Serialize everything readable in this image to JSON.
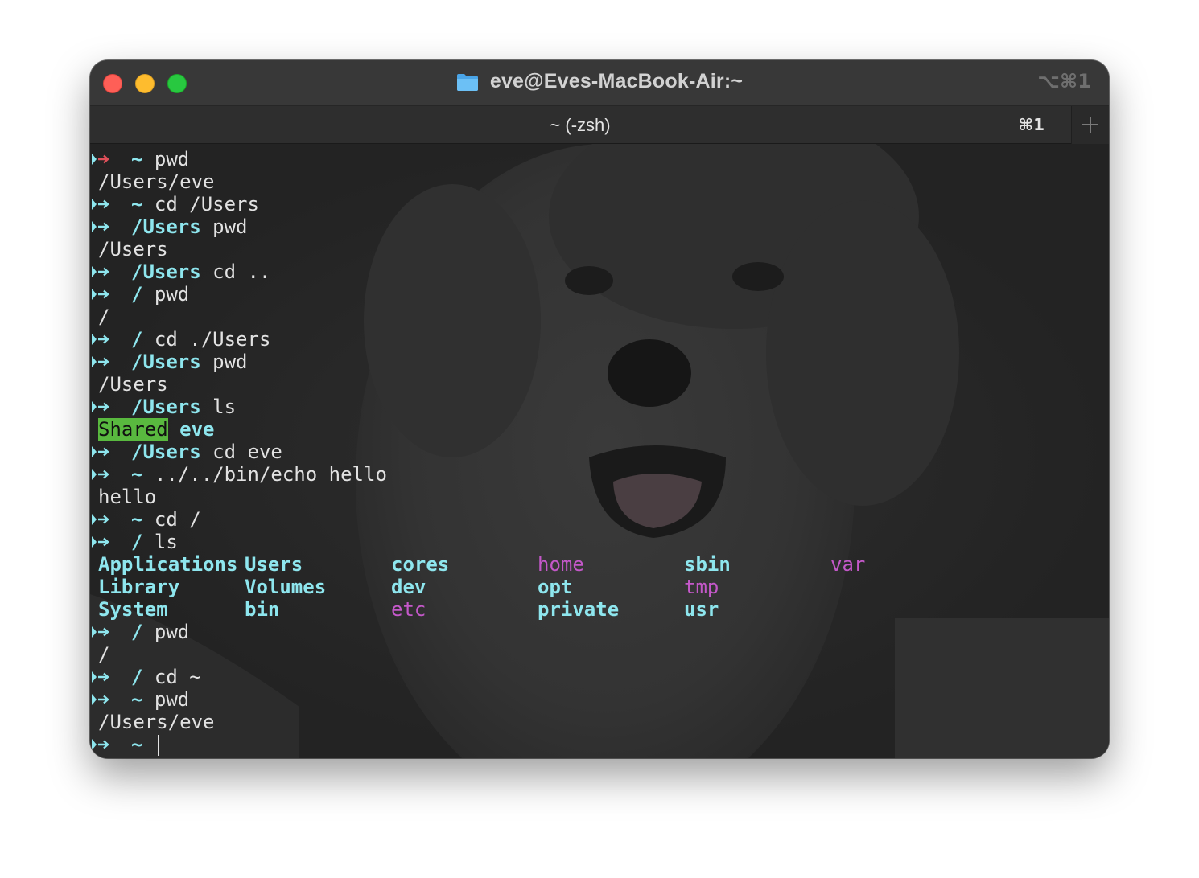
{
  "window": {
    "title": "eve@Eves-MacBook-Air:~",
    "title_icon": "folder-icon",
    "shortcut": "⌥⌘1"
  },
  "tabs": [
    {
      "label": "~ (-zsh)",
      "shortcut": "⌘1",
      "active": true
    }
  ],
  "new_tab_icon": "plus-icon",
  "prompt_icon": "arrow-right-icon",
  "colors": {
    "prompt_arrow": "#8ee6ee",
    "prompt_dir": "#8ee6ee",
    "error_arrow": "#e0505a",
    "magenta": "#c458c9",
    "shared_highlight": "#59b93f",
    "text": "#e2e2e2"
  },
  "terminal": {
    "lines": [
      {
        "type": "prompt",
        "status": "error",
        "dir": "~",
        "cmd": "pwd"
      },
      {
        "type": "output",
        "text": "/Users/eve"
      },
      {
        "type": "prompt",
        "status": "ok",
        "dir": "~",
        "cmd": "cd /Users"
      },
      {
        "type": "prompt",
        "status": "ok",
        "dir": "/Users",
        "cmd": "pwd"
      },
      {
        "type": "output",
        "text": "/Users"
      },
      {
        "type": "prompt",
        "status": "ok",
        "dir": "/Users",
        "cmd": "cd .."
      },
      {
        "type": "prompt",
        "status": "ok",
        "dir": "/",
        "cmd": "pwd"
      },
      {
        "type": "output",
        "text": "/"
      },
      {
        "type": "prompt",
        "status": "ok",
        "dir": "/",
        "cmd": "cd ./Users"
      },
      {
        "type": "prompt",
        "status": "ok",
        "dir": "/Users",
        "cmd": "pwd"
      },
      {
        "type": "output",
        "text": "/Users"
      },
      {
        "type": "prompt",
        "status": "ok",
        "dir": "/Users",
        "cmd": "ls"
      },
      {
        "type": "ls_users",
        "items": [
          "Shared",
          "eve"
        ]
      },
      {
        "type": "prompt",
        "status": "ok",
        "dir": "/Users",
        "cmd": "cd eve"
      },
      {
        "type": "prompt",
        "status": "ok",
        "dir": "~",
        "cmd": "../../bin/echo hello"
      },
      {
        "type": "output",
        "text": "hello"
      },
      {
        "type": "prompt",
        "status": "ok",
        "dir": "~",
        "cmd": "cd /"
      },
      {
        "type": "prompt",
        "status": "ok",
        "dir": "/",
        "cmd": "ls"
      },
      {
        "type": "ls_row",
        "cells": [
          {
            "text": "Applications",
            "style": "dir"
          },
          {
            "text": "Users",
            "style": "dir"
          },
          {
            "text": "cores",
            "style": "dir"
          },
          {
            "text": "home",
            "style": "link"
          },
          {
            "text": "sbin",
            "style": "dir"
          },
          {
            "text": "var",
            "style": "link"
          }
        ]
      },
      {
        "type": "ls_row",
        "cells": [
          {
            "text": "Library",
            "style": "dir"
          },
          {
            "text": "Volumes",
            "style": "dir"
          },
          {
            "text": "dev",
            "style": "dir"
          },
          {
            "text": "opt",
            "style": "dir"
          },
          {
            "text": "tmp",
            "style": "link"
          }
        ]
      },
      {
        "type": "ls_row",
        "cells": [
          {
            "text": "System",
            "style": "dir"
          },
          {
            "text": "bin",
            "style": "dir"
          },
          {
            "text": "etc",
            "style": "link"
          },
          {
            "text": "private",
            "style": "dir"
          },
          {
            "text": "usr",
            "style": "dir"
          }
        ]
      },
      {
        "type": "prompt",
        "status": "ok",
        "dir": "/",
        "cmd": "pwd"
      },
      {
        "type": "output",
        "text": "/"
      },
      {
        "type": "prompt",
        "status": "ok",
        "dir": "/",
        "cmd": "cd ~"
      },
      {
        "type": "prompt",
        "status": "ok",
        "dir": "~",
        "cmd": "pwd"
      },
      {
        "type": "output",
        "text": "/Users/eve"
      },
      {
        "type": "prompt",
        "status": "ok",
        "dir": "~",
        "cmd": "",
        "cursor": true
      }
    ]
  }
}
